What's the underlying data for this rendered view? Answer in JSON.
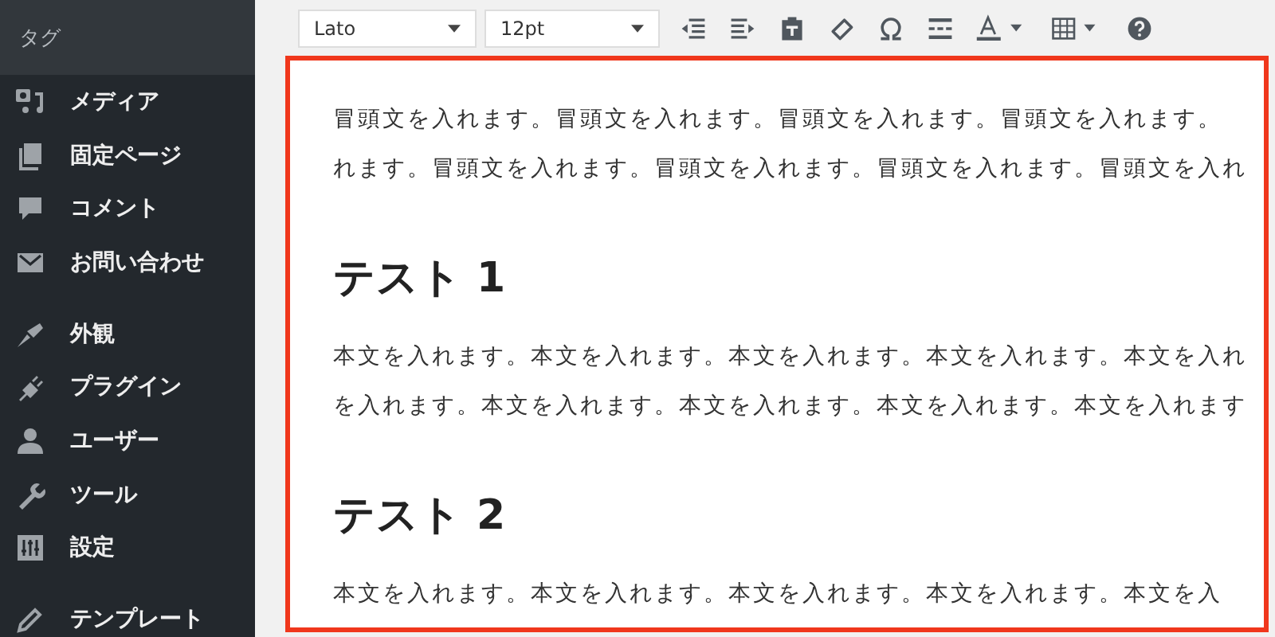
{
  "sidebar": {
    "submenu": [
      {
        "label": "タグ"
      }
    ],
    "menu_groups": [
      [
        {
          "label": "メディア"
        },
        {
          "label": "固定ページ"
        },
        {
          "label": "コメント"
        },
        {
          "label": "お問い合わせ"
        }
      ],
      [
        {
          "label": "外観"
        },
        {
          "label": "プラグイン"
        },
        {
          "label": "ユーザー"
        },
        {
          "label": "ツール"
        },
        {
          "label": "設定"
        }
      ],
      [
        {
          "label": "テンプレート"
        }
      ]
    ]
  },
  "toolbar": {
    "font_family": {
      "value": "Lato"
    },
    "font_size": {
      "value": "12pt"
    }
  },
  "editor": {
    "blocks": [
      {
        "kind": "paragraph",
        "lines": [
          "冒頭文を入れます。冒頭文を入れます。冒頭文を入れます。冒頭文を入れます。",
          "れます。冒頭文を入れます。冒頭文を入れます。冒頭文を入れます。冒頭文を入れ"
        ]
      },
      {
        "kind": "heading",
        "text": "テスト 1"
      },
      {
        "kind": "paragraph",
        "lines": [
          "本文を入れます。本文を入れます。本文を入れます。本文を入れます。本文を入れ",
          "を入れます。本文を入れます。本文を入れます。本文を入れます。本文を入れます"
        ]
      },
      {
        "kind": "heading",
        "text": "テスト 2"
      },
      {
        "kind": "paragraph",
        "lines": [
          "本文を入れます。本文を入れます。本文を入れます。本文を入れます。本文を入"
        ]
      }
    ]
  }
}
